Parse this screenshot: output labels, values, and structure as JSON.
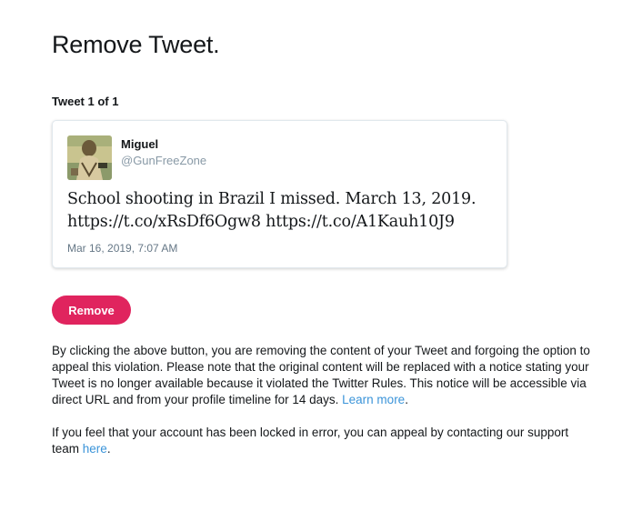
{
  "page": {
    "title": "Remove Tweet.",
    "tweet_count": "Tweet 1 of 1"
  },
  "tweet": {
    "author_name": "Miguel",
    "author_handle": "@GunFreeZone",
    "text_line1": "School shooting in Brazil I missed. March 13, 2019.",
    "text_line2": "https://t.co/xRsDf6Ogw8 https://t.co/A1Kauh10J9",
    "timestamp": "Mar 16, 2019, 7:07 AM",
    "avatar_icon": "user-avatar-icon"
  },
  "actions": {
    "remove_label": "Remove"
  },
  "info": {
    "text": "By clicking the above button, you are removing the content of your Tweet and forgoing the option to appeal this violation. Please note that the original content will be replaced with a notice stating your Tweet is no longer available because it violated the Twitter Rules. This notice will be accessible via direct URL and from your profile timeline for 14 days.",
    "learn_more": "Learn more",
    "after_link": "."
  },
  "appeal": {
    "text": "If you feel that your account has been locked in error, you can appeal by contacting our support team",
    "link": "here",
    "after_link": "."
  },
  "colors": {
    "accent": "#e0245e",
    "link": "#3b94d9",
    "muted": "#8899a6"
  }
}
